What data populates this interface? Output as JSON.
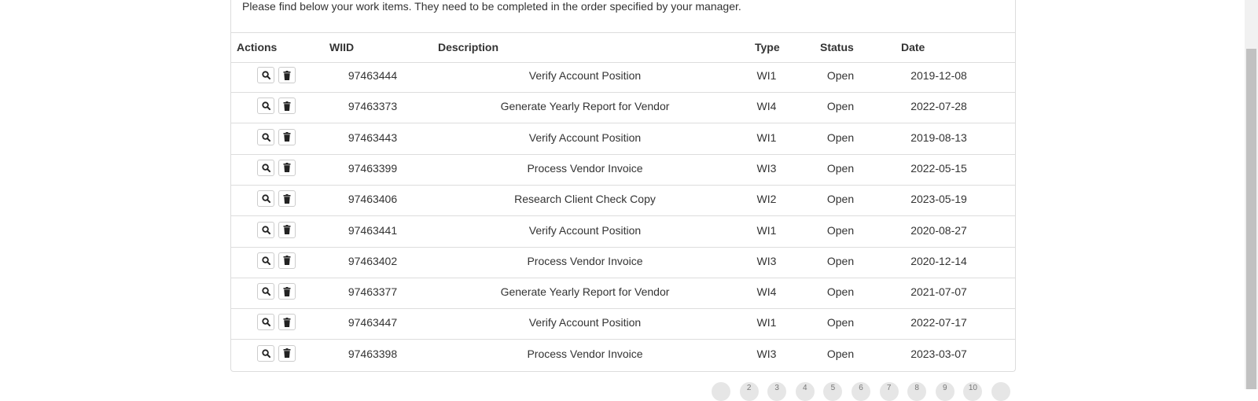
{
  "intro_text": "Please find below your work items. They need to be completed in the order specified by your manager.",
  "table": {
    "headers": {
      "actions": "Actions",
      "wiid": "WIID",
      "description": "Description",
      "type": "Type",
      "status": "Status",
      "date": "Date"
    },
    "rows": [
      {
        "wiid": "97463444",
        "description": "Verify Account Position",
        "type": "WI1",
        "status": "Open",
        "date": "2019-12-08"
      },
      {
        "wiid": "97463373",
        "description": "Generate Yearly Report for Vendor",
        "type": "WI4",
        "status": "Open",
        "date": "2022-07-28"
      },
      {
        "wiid": "97463443",
        "description": "Verify Account Position",
        "type": "WI1",
        "status": "Open",
        "date": "2019-08-13"
      },
      {
        "wiid": "97463399",
        "description": "Process Vendor Invoice",
        "type": "WI3",
        "status": "Open",
        "date": "2022-05-15"
      },
      {
        "wiid": "97463406",
        "description": "Research Client Check Copy",
        "type": "WI2",
        "status": "Open",
        "date": "2023-05-19"
      },
      {
        "wiid": "97463441",
        "description": "Verify Account Position",
        "type": "WI1",
        "status": "Open",
        "date": "2020-08-27"
      },
      {
        "wiid": "97463402",
        "description": "Process Vendor Invoice",
        "type": "WI3",
        "status": "Open",
        "date": "2020-12-14"
      },
      {
        "wiid": "97463377",
        "description": "Generate Yearly Report for Vendor",
        "type": "WI4",
        "status": "Open",
        "date": "2021-07-07"
      },
      {
        "wiid": "97463447",
        "description": "Verify Account Position",
        "type": "WI1",
        "status": "Open",
        "date": "2022-07-17"
      },
      {
        "wiid": "97463398",
        "description": "Process Vendor Invoice",
        "type": "WI3",
        "status": "Open",
        "date": "2023-03-07"
      }
    ],
    "row_action_icons": [
      "search-icon",
      "trash-icon"
    ]
  },
  "pagination": {
    "pages": [
      "",
      "2",
      "3",
      "4",
      "5",
      "6",
      "7",
      "8",
      "9",
      "10",
      ""
    ]
  }
}
